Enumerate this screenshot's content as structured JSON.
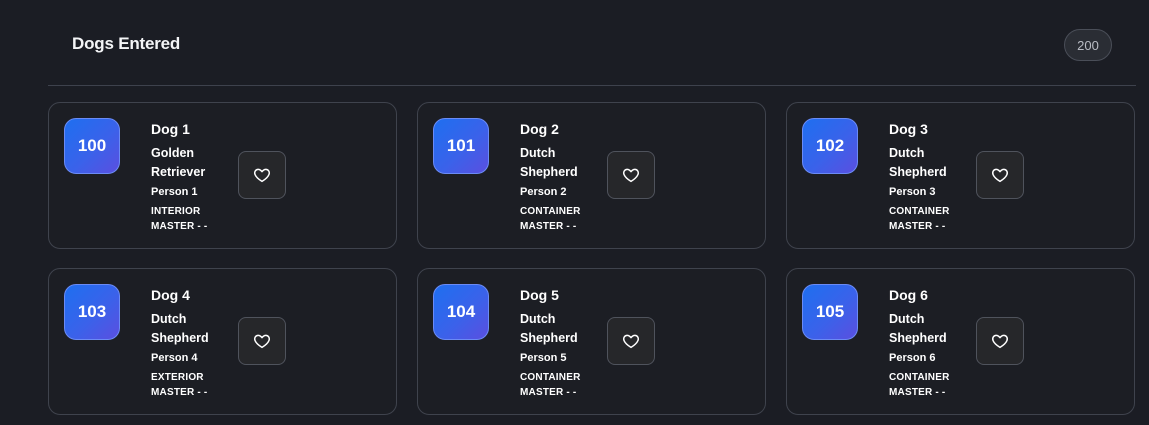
{
  "header": {
    "title": "Dogs Entered",
    "count": "200"
  },
  "dogs": [
    {
      "number": "100",
      "name": "Dog 1",
      "breed": "Golden Retriever",
      "owner": "Person 1",
      "class": "INTERIOR MASTER - -"
    },
    {
      "number": "101",
      "name": "Dog 2",
      "breed": "Dutch Shepherd",
      "owner": "Person 2",
      "class": "CONTAINER MASTER - -"
    },
    {
      "number": "102",
      "name": "Dog 3",
      "breed": "Dutch Shepherd",
      "owner": "Person 3",
      "class": "CONTAINER MASTER - -"
    },
    {
      "number": "103",
      "name": "Dog 4",
      "breed": "Dutch Shepherd",
      "owner": "Person 4",
      "class": "EXTERIOR MASTER - -"
    },
    {
      "number": "104",
      "name": "Dog 5",
      "breed": "Dutch Shepherd",
      "owner": "Person 5",
      "class": "CONTAINER MASTER - -"
    },
    {
      "number": "105",
      "name": "Dog 6",
      "breed": "Dutch Shepherd",
      "owner": "Person 6",
      "class": "CONTAINER MASTER - -"
    }
  ],
  "icons": {
    "favorite": "heart-outline-icon"
  },
  "colors": {
    "background": "#1b1d24",
    "badge_gradient_start": "#1e6ff0",
    "badge_gradient_end": "#5a4fe0"
  }
}
